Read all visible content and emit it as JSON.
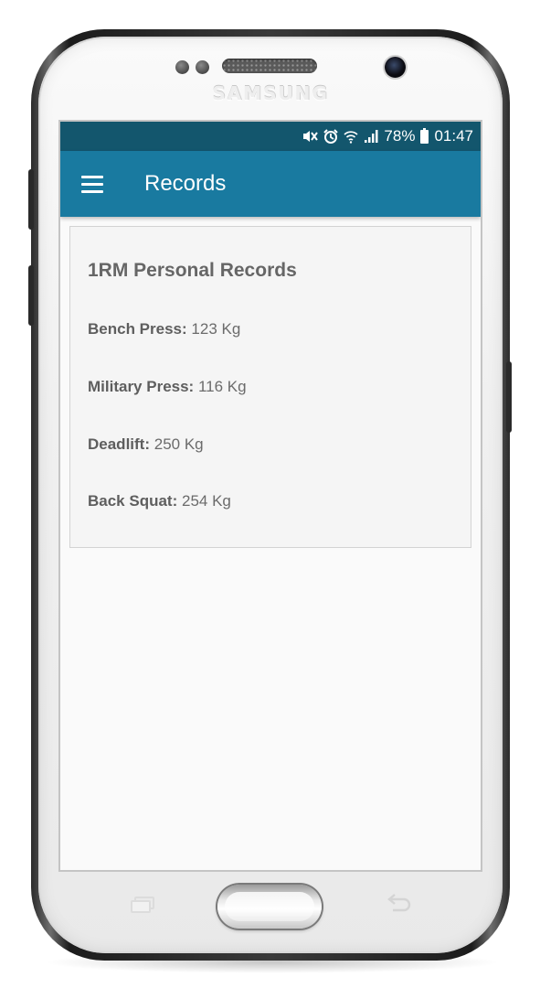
{
  "device": {
    "brand_logo": "SAMSUNG"
  },
  "status_bar": {
    "icons": [
      "mute-vibrate-icon",
      "alarm-icon",
      "wifi-icon",
      "cell-signal-icon",
      "battery-icon"
    ],
    "battery_percent": "78%",
    "time": "01:47"
  },
  "app_bar": {
    "menu_icon": "hamburger-menu-icon",
    "title": "Records"
  },
  "card": {
    "heading": "1RM Personal Records",
    "records": [
      {
        "label": "Bench Press:",
        "value": "123 Kg"
      },
      {
        "label": "Military Press:",
        "value": "116 Kg"
      },
      {
        "label": "Deadlift:",
        "value": "250 Kg"
      },
      {
        "label": "Back Squat:",
        "value": "254 Kg"
      }
    ]
  },
  "nav_keys": {
    "recents_icon": "recents-icon",
    "home_icon": "home-button",
    "back_icon": "back-icon"
  },
  "colors": {
    "status_bar": "#13566d",
    "app_bar": "#197aa0",
    "screen_bg": "#fafafa",
    "card_bg": "#f5f5f5"
  }
}
